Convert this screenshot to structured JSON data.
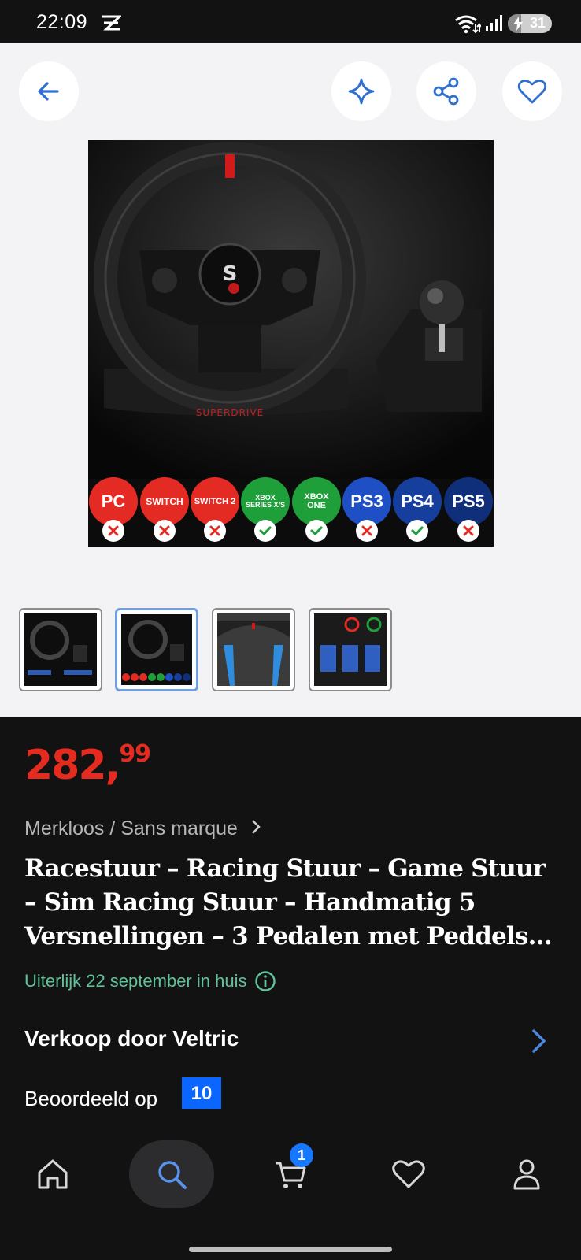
{
  "status_bar": {
    "time": "22:09",
    "app_icon": "notification-app-icon",
    "wifi_icon": "wifi-icon",
    "signal_icon": "signal-icon",
    "battery_level": "31",
    "battery_fraction": 0.31
  },
  "top_actions": {
    "back": "arrow-left-icon",
    "ai": "sparkle-icon",
    "share": "share-icon",
    "favorite": "heart-icon"
  },
  "product_image": {
    "brand_mark": "SUPERDRIVE",
    "compatibility": [
      {
        "label": "PC",
        "supported": false,
        "color": "#e32b24"
      },
      {
        "label": "SWITCH",
        "supported": false,
        "color": "#e32b24"
      },
      {
        "label": "SWITCH 2",
        "supported": false,
        "color": "#e32b24"
      },
      {
        "label": "XBOX SERIES X/S",
        "supported": true,
        "color": "#1e9f3a"
      },
      {
        "label": "XBOX ONE",
        "supported": true,
        "color": "#1e9f3a"
      },
      {
        "label": "PS3",
        "supported": false,
        "color": "#1e4fc4"
      },
      {
        "label": "PS4",
        "supported": true,
        "color": "#163e9c"
      },
      {
        "label": "PS5",
        "supported": false,
        "color": "#102f7a"
      }
    ]
  },
  "thumbnails": {
    "count": 4,
    "active_index": 1
  },
  "price": {
    "whole": "282,",
    "cents": "99",
    "color": "#e52b1f"
  },
  "brand": {
    "label": "Merkloos / Sans marque",
    "chevron": "chevron-right-icon"
  },
  "title": "Racestuur – Racing Stuur – Game Stuur – Sim Racing Stuur – Handmatig 5 Versnellingen – 3 Pedalen met Peddels…",
  "delivery": {
    "text": "Uiterlijk 22 september in huis",
    "icon": "info-icon",
    "color": "#5fc39a"
  },
  "seller": {
    "label": "Verkoop door Veltric",
    "chevron": "chevron-right-icon"
  },
  "rating": {
    "label": "Beoordeeld op",
    "score": "10"
  },
  "bottom_nav": {
    "home": "home-icon",
    "search": "search-icon",
    "cart": "cart-icon",
    "cart_count": "1",
    "favorites": "heart-icon",
    "account": "user-icon"
  },
  "accent_color": "#0a66ff"
}
